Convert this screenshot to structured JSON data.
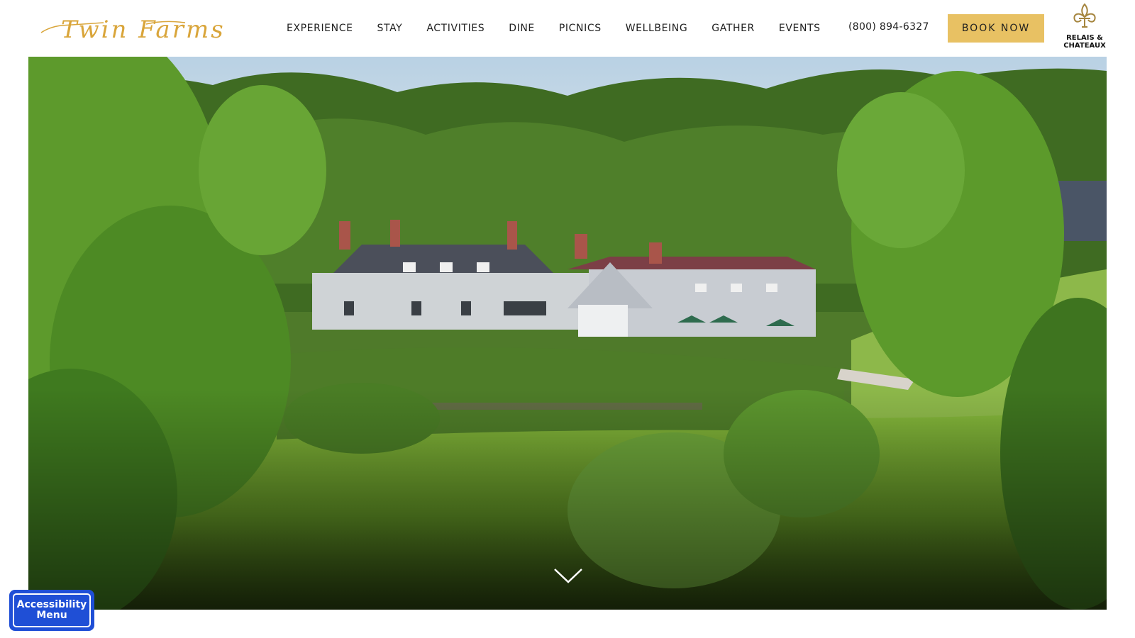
{
  "brand": {
    "logo_text": "Twin Farms",
    "logo_color": "#d9a53a"
  },
  "nav": {
    "items": [
      {
        "label": "EXPERIENCE"
      },
      {
        "label": "STAY"
      },
      {
        "label": "ACTIVITIES"
      },
      {
        "label": "DINE"
      },
      {
        "label": "PICNICS"
      },
      {
        "label": "WELLBEING"
      },
      {
        "label": "GATHER"
      },
      {
        "label": "EVENTS"
      }
    ]
  },
  "contact": {
    "phone": "(800) 894-6327"
  },
  "cta": {
    "book_label": "BOOK NOW",
    "button_color": "#e8c163"
  },
  "affiliation": {
    "line1": "RELAIS &",
    "line2": "CHATEAUX",
    "icon": "fleur-de-lis-icon"
  },
  "hero": {
    "scroll_icon": "chevron-down-icon"
  },
  "accessibility": {
    "line1": "Accessibility",
    "line2": "Menu",
    "color": "#1f4fd6"
  }
}
